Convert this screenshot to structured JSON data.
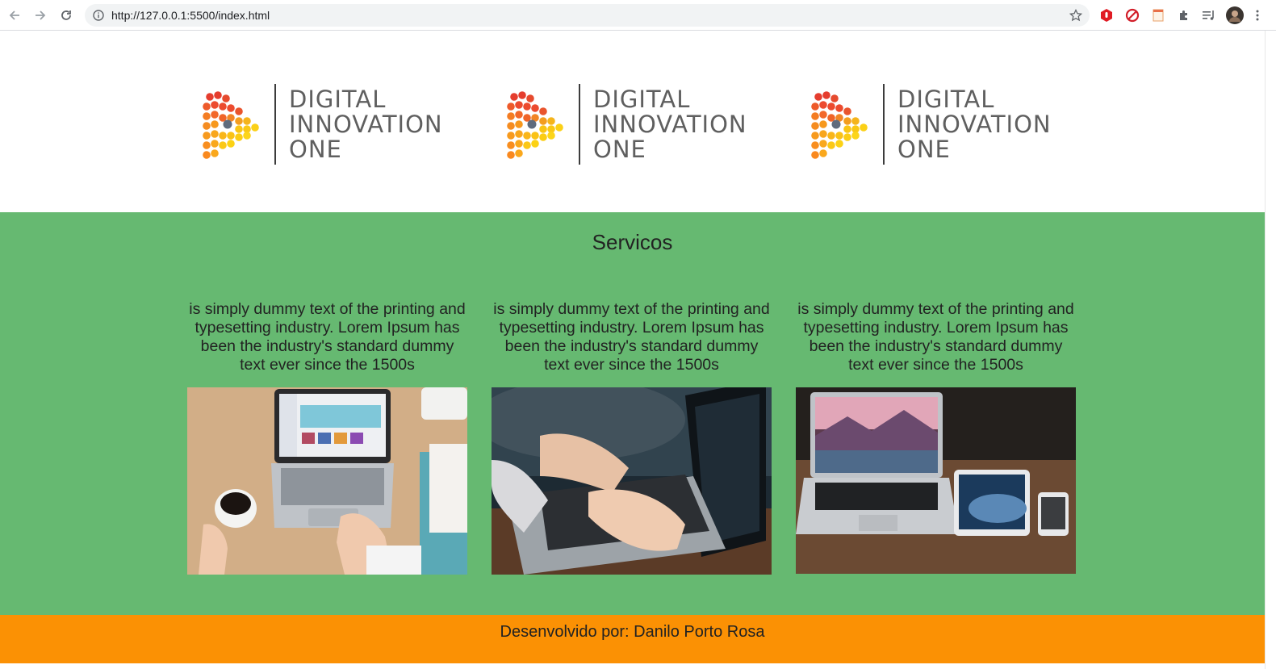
{
  "browser": {
    "url": "http://127.0.0.1:5500/index.html",
    "back_icon": "back-arrow-icon",
    "forward_icon": "forward-arrow-icon",
    "reload_icon": "reload-icon",
    "info_icon": "info-icon",
    "bookmark_icon": "star-icon",
    "extensions": [
      "adblock-icon",
      "block-icon",
      "notes-icon",
      "puzzle-extension-icon",
      "media-queue-icon",
      "profile-avatar"
    ]
  },
  "header": {
    "logos": [
      {
        "line1": "DIGITAL",
        "line2": "INNOVATION",
        "line3": "ONE"
      },
      {
        "line1": "DIGITAL",
        "line2": "INNOVATION",
        "line3": "ONE"
      },
      {
        "line1": "DIGITAL",
        "line2": "INNOVATION",
        "line3": "ONE"
      }
    ]
  },
  "services": {
    "title": "Servicos",
    "cards": [
      {
        "text": "is simply dummy text of the printing and typesetting industry. Lorem Ipsum has been the industry's standard dummy text ever since the 1500s",
        "image": "laptop-desk-photo"
      },
      {
        "text": "is simply dummy text of the printing and typesetting industry. Lorem Ipsum has been the industry's standard dummy text ever since the 1500s",
        "image": "typing-laptop-photo"
      },
      {
        "text": "is simply dummy text of the printing and typesetting industry. Lorem Ipsum has been the industry's standard dummy text ever since the 1500s",
        "image": "apple-devices-photo"
      }
    ]
  },
  "footer": {
    "credit": "Desenvolvido por: Danilo Porto Rosa"
  },
  "colors": {
    "services_bg": "#66b971",
    "footer_bg": "#fb9104",
    "logo_text": "#5f5f5f"
  }
}
